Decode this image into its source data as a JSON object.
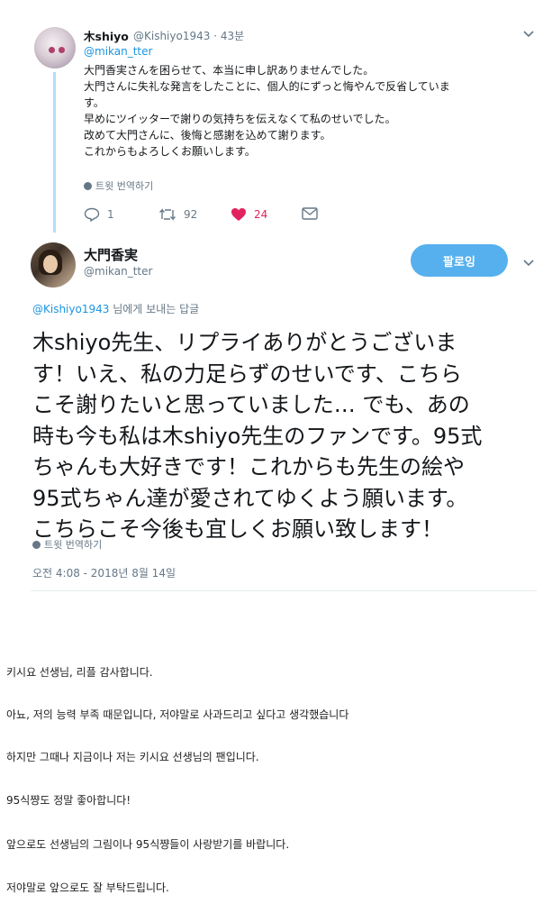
{
  "tweet1": {
    "display_name": "木shiyo",
    "handle": "@Kishiyo1943",
    "time_ago": "43분",
    "replying_to": "@mikan_tter",
    "lines": [
      "大門香実さんを困らせて、本当に申し訳ありませんでした。",
      "大門さんに失礼な発言をしたことに、個人的にずっと悔やんで反省していま",
      "す。",
      "早めにツイッターで謝りの気持ちを伝えなくて私のせいでした。",
      "改めて大門さんに、後悔と感謝を込めて謝ります。",
      "これからもよろしくお願いします。"
    ],
    "translate": "트윗 번역하기",
    "reply_count": "1",
    "retweet_count": "92",
    "like_count": "24",
    "like_color": "#e0245e"
  },
  "tweet2": {
    "display_name": "大門香実",
    "handle": "@mikan_tter",
    "follow_label": "팔로잉",
    "reply_mention": "@Kishiyo1943",
    "reply_suffix": " 님에게 보내는 답글",
    "lines": [
      "木shiyo先生、リプライありがとうございま",
      "す！いえ、私の力足らずのせいです、こちら",
      "こそ謝りたいと思っていました… でも、あの",
      "時も今も私は木shiyo先生のファンです。95式",
      "ちゃんも大好きです！これからも先生の絵や",
      "95式ちゃん達が愛されてゆくよう願います。",
      "こちらこそ今後も宜しくお願い致します！"
    ],
    "translate": "트윗 번역하기",
    "timestamp": "오전 4:08 - 2018년 8월 14일"
  },
  "translation_lines": [
    "키시요 선생님, 리플 감사합니다.",
    "아뇨, 저의 능력 부족 때문입니다, 저야말로 사과드리고 싶다고 생각했습니다",
    "하지만 그때나 지금이나 저는 키시요 선생님의 팬입니다.",
    "95식쨩도 정말 좋아합니다!",
    "앞으로도 선생님의 그림이나 95식쨩들이 사랑받기를 바랍니다.",
    "저야말로 앞으로도 잘 부탁드립니다."
  ],
  "colors": {
    "accent": "#1b95e0",
    "follow_bg": "#56b0ee",
    "thread_line": "#b5dcf3",
    "muted": "#657786"
  }
}
